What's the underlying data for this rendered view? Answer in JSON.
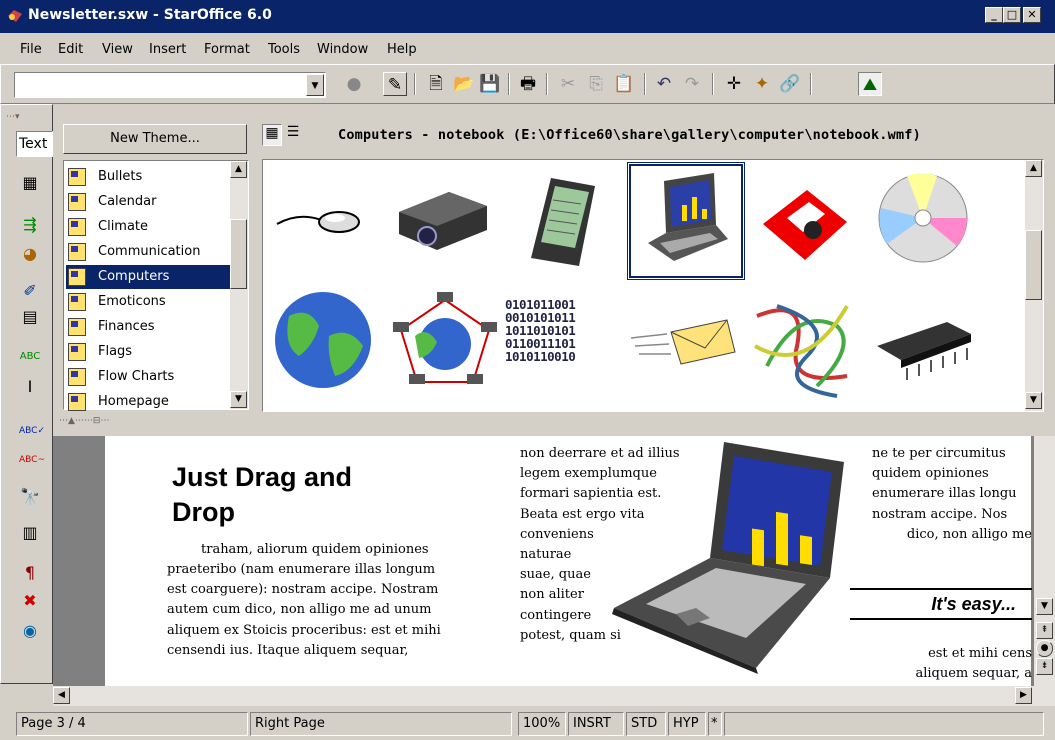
{
  "window": {
    "title": "Newsletter.sxw - StarOffice 6.0",
    "min": "_",
    "max": "□",
    "close": "✕"
  },
  "menu": [
    "File",
    "Edit",
    "View",
    "Insert",
    "Format",
    "Tools",
    "Window",
    "Help"
  ],
  "url_combo": {
    "value": ""
  },
  "left_toolbar": {
    "text_field": "Text"
  },
  "gallery": {
    "new_theme": "New Theme...",
    "path_title": "Computers - notebook (E:\\Office60\\share\\gallery\\computer\\notebook.wmf)",
    "themes": [
      "Bullets",
      "Calendar",
      "Climate",
      "Communication",
      "Computers",
      "Emoticons",
      "Finances",
      "Flags",
      "Flow Charts",
      "Homepage"
    ],
    "selected_theme": "Computers",
    "thumbnails": [
      "mouse",
      "projector",
      "pda",
      "notebook",
      "floppy-disk",
      "cd",
      "globe",
      "network",
      "binary-data",
      "email",
      "cables",
      "chip"
    ],
    "binary_text": [
      "0101011001",
      "0010101011",
      "1011010101",
      "0110011101",
      "1010110010"
    ]
  },
  "document": {
    "heading_line1": "Just Drag and",
    "heading_line2": "Drop",
    "col1": [
      "traham, aliorum quidem opiniones",
      "praeteribo (nam enumerare illas longum",
      "est coarguere): nostram accipe. Nostram",
      "autem cum dico, non alligo me ad unum",
      "aliquem ex Stoicis proceribus: est et mihi",
      "censendi ius. Itaque aliquem sequar,"
    ],
    "col2": [
      "non deerrare et ad illius",
      "legem exemplumque",
      "formari sapientia est.",
      "Beata est ergo vita",
      "conveniens",
      "naturae",
      "suae, quae",
      "non aliter",
      "contingere",
      "potest, quam si"
    ],
    "col3": [
      "ne te per circumitus",
      "quidem opiniones",
      "enumerare illas longu",
      "nostram accipe. Nos",
      "dico, non alligo me"
    ],
    "col3_bottom": [
      "est et mihi cens",
      "aliquem sequar, a"
    ],
    "callout": "It's easy..."
  },
  "status": {
    "page": "Page 3 / 4",
    "style": "Right Page",
    "zoom": "100%",
    "insert": "INSRT",
    "sel": "STD",
    "hyp": "HYP",
    "mod": "*"
  }
}
